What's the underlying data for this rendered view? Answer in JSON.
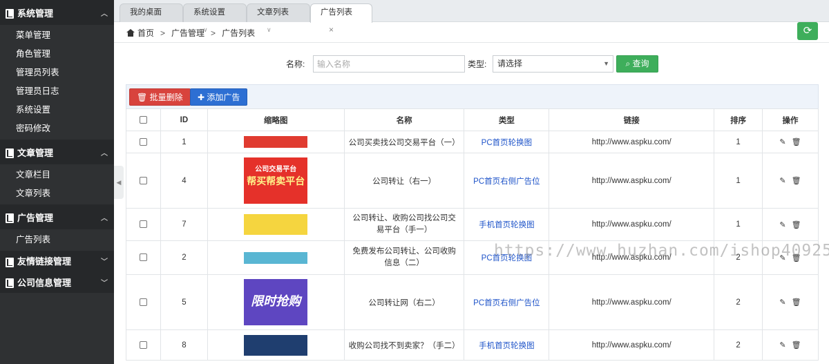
{
  "sidebar": {
    "groups": [
      {
        "label": "系统管理",
        "items": [
          "菜单管理",
          "角色管理",
          "管理员列表",
          "管理员日志",
          "系统设置",
          "密码修改"
        ]
      },
      {
        "label": "文章管理",
        "items": [
          "文章栏目",
          "文章列表"
        ]
      },
      {
        "label": "广告管理",
        "items": [
          "广告列表"
        ]
      },
      {
        "label": "友情链接管理",
        "items": []
      },
      {
        "label": "公司信息管理",
        "items": []
      }
    ]
  },
  "tabs": [
    {
      "label": "我的桌面"
    },
    {
      "label": "系统设置"
    },
    {
      "label": "文章列表"
    },
    {
      "label": "广告列表",
      "active": true
    }
  ],
  "breadcrumb": {
    "home": "首页",
    "section": "广告管理",
    "page": "广告列表"
  },
  "search": {
    "name_label": "名称:",
    "name_placeholder": "输入名称",
    "type_label": "类型:",
    "type_selected": "请选择",
    "query_button": "查询"
  },
  "toolbar": {
    "batch_delete": "批量删除",
    "add": "添加广告"
  },
  "table": {
    "headers": {
      "id": "ID",
      "thumb": "缩略图",
      "name": "名称",
      "type": "类型",
      "link": "链接",
      "sort": "排序",
      "ops": "操作"
    },
    "rows": [
      {
        "id": "1",
        "name": "公司买卖找公司交易平台（一）",
        "type": "PC首页轮换图",
        "link": "http://www.aspku.com/",
        "sort": "1"
      },
      {
        "id": "4",
        "name": "公司转让（右一）",
        "type": "PC首页右侧广告位",
        "link": "http://www.aspku.com/",
        "sort": "1",
        "thumb_text": "公司交易平台",
        "thumb_big": "帮买帮卖平台"
      },
      {
        "id": "7",
        "name": "公司转让、收购公司找公司交易平台（手一）",
        "type": "手机首页轮换图",
        "link": "http://www.aspku.com/",
        "sort": "1"
      },
      {
        "id": "2",
        "name": "免费发布公司转让、公司收购信息（二）",
        "type": "PC首页轮换图",
        "link": "http://www.aspku.com/",
        "sort": "2"
      },
      {
        "id": "5",
        "name": "公司转让网（右二）",
        "type": "PC首页右侧广告位",
        "link": "http://www.aspku.com/",
        "sort": "2",
        "thumb_big": "限时抢购"
      },
      {
        "id": "8",
        "name": "收购公司找不到卖家？（手二）",
        "type": "手机首页轮换图",
        "link": "http://www.aspku.com/",
        "sort": "2"
      }
    ]
  },
  "watermark": "https://www.huzhan.com/ishop40925"
}
